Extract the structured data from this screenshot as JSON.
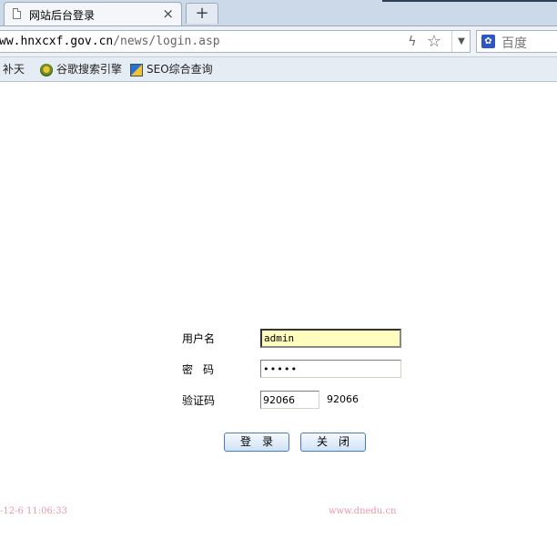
{
  "browser": {
    "tab": {
      "title": "网站后台登录",
      "close_glyph": "×"
    },
    "new_tab_glyph": "+",
    "address": {
      "host": "ww.hnxcxf.gov.cn",
      "path": "/news/login.asp"
    },
    "search": {
      "placeholder": "百度"
    },
    "bookmarks": [
      {
        "label": "补天",
        "icon": ""
      },
      {
        "label": "谷歌搜索引擎",
        "icon": "google-icon"
      },
      {
        "label": "SEO综合查询",
        "icon": "seo-icon"
      }
    ]
  },
  "login": {
    "username_label": "用户名",
    "password_label": "密码",
    "code_label": "验证码",
    "username_value": "admin",
    "password_value": "•••••",
    "code_value": "92066",
    "code_display": "92066",
    "login_button": "登录",
    "close_button": "关闭"
  },
  "footer": {
    "timestamp": "-12-6 11:06:33",
    "site": "www.dnedu.cn"
  },
  "colors": {
    "username_bg": "#fffdbe",
    "footer_text": "#e79aa7",
    "button_border": "#4a7db4"
  }
}
